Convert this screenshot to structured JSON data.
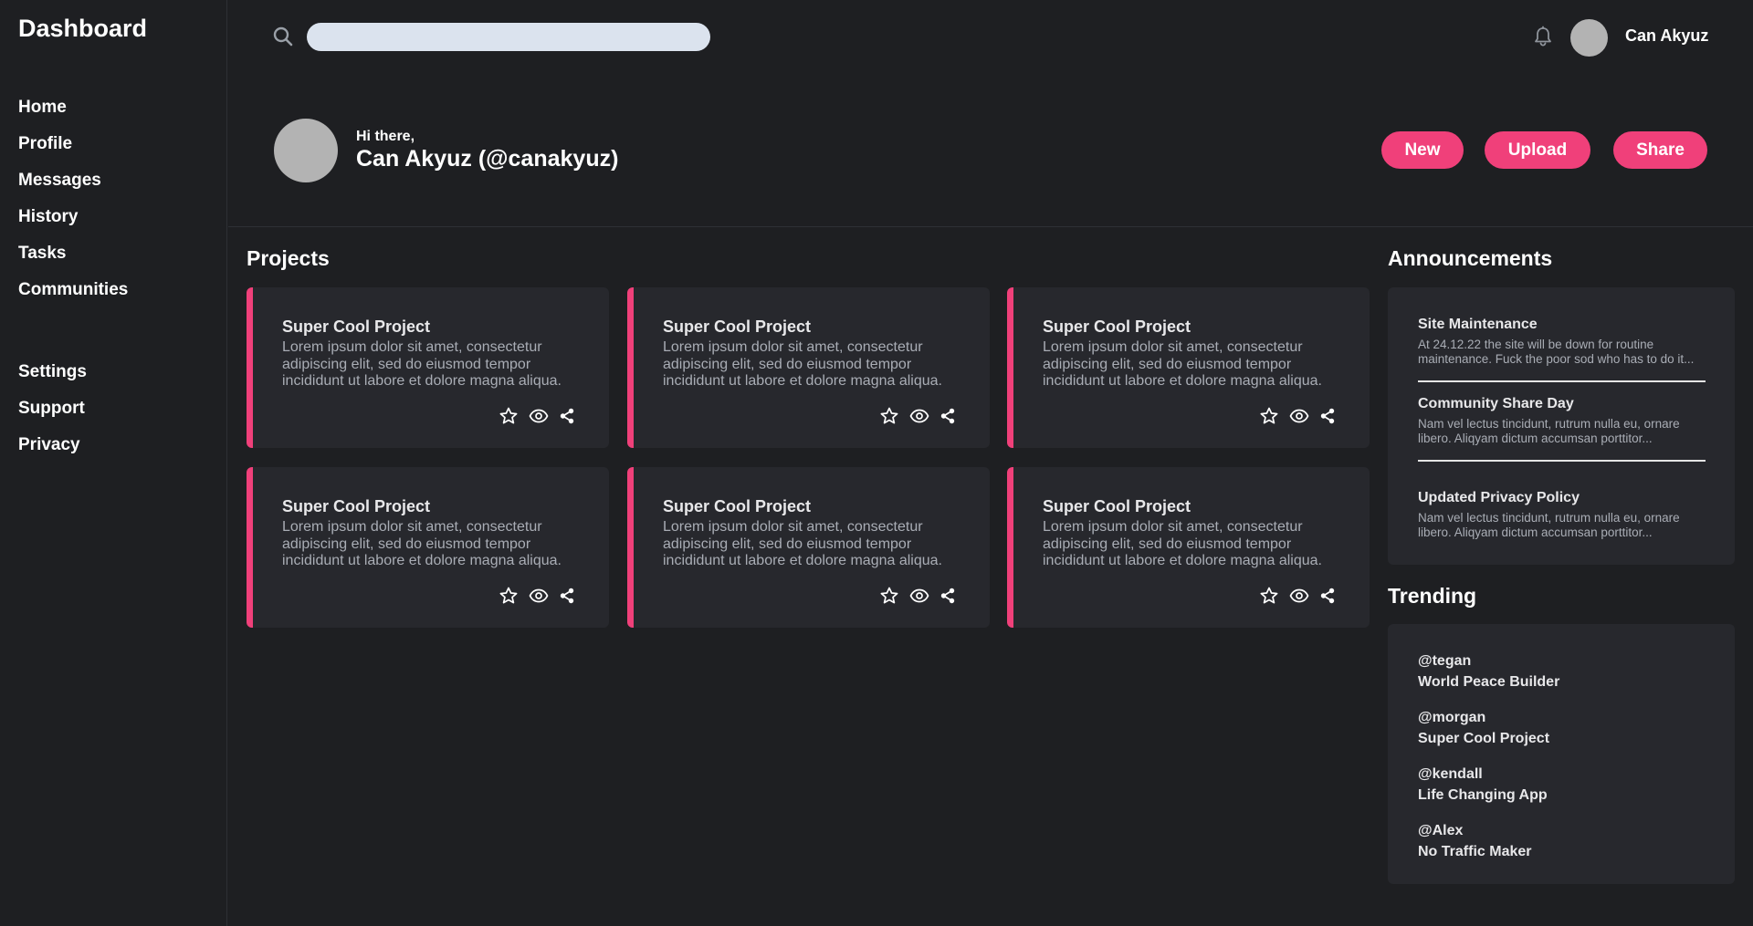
{
  "sidebar": {
    "brand": "Dashboard",
    "nav_primary": [
      "Home",
      "Profile",
      "Messages",
      "History",
      "Tasks",
      "Communities"
    ],
    "nav_secondary": [
      "Settings",
      "Support",
      "Privacy"
    ]
  },
  "topbar": {
    "search_placeholder": "",
    "username": "Can Akyuz"
  },
  "greeting": {
    "small": "Hi there,",
    "big": "Can Akyuz (@canakyuz)",
    "buttons": {
      "new": "New",
      "upload": "Upload",
      "share": "Share"
    }
  },
  "projects": {
    "title": "Projects",
    "cards": [
      {
        "title": "Super Cool Project",
        "desc": "Lorem ipsum dolor sit amet, consectetur adipiscing elit, sed do eiusmod tempor incididunt ut labore et dolore magna aliqua. Ut enim ad minim veniam"
      },
      {
        "title": "Super Cool Project",
        "desc": "Lorem ipsum dolor sit amet, consectetur adipiscing elit, sed do eiusmod tempor incididunt ut labore et dolore magna aliqua. Ut enim ad minim veniam"
      },
      {
        "title": "Super Cool Project",
        "desc": "Lorem ipsum dolor sit amet, consectetur adipiscing elit, sed do eiusmod tempor incididunt ut labore et dolore magna aliqua. Ut enim ad minim veniam"
      },
      {
        "title": "Super Cool Project",
        "desc": "Lorem ipsum dolor sit amet, consectetur adipiscing elit, sed do eiusmod tempor incididunt ut labore et dolore magna aliqua. Ut enim ad minim veniam"
      },
      {
        "title": "Super Cool Project",
        "desc": "Lorem ipsum dolor sit amet, consectetur adipiscing elit, sed do eiusmod tempor incididunt ut labore et dolore magna aliqua. Ut enim ad minim veniam"
      },
      {
        "title": "Super Cool Project",
        "desc": "Lorem ipsum dolor sit amet, consectetur adipiscing elit, sed do eiusmod tempor incididunt ut labore et dolore magna aliqua. Ut enim ad minim veniam"
      }
    ],
    "card_action_icons": [
      "star-icon",
      "eye-icon",
      "share-icon"
    ]
  },
  "announcements": {
    "title": "Announcements",
    "items": [
      {
        "title": "Site Maintenance",
        "text": "At 24.12.22 the site will be down for routine maintenance. Fuck the poor sod who has to do it..."
      },
      {
        "title": "Community Share Day",
        "text": "Nam vel lectus tincidunt, rutrum nulla eu, ornare libero. Aliqyam dictum accumsan porttitor..."
      },
      {
        "title": "Updated Privacy Policy",
        "text": "Nam vel lectus tincidunt, rutrum nulla eu, ornare libero. Aliqyam dictum accumsan porttitor..."
      }
    ]
  },
  "trending": {
    "title": "Trending",
    "items": [
      {
        "handle": "@tegan",
        "project": "World Peace Builder"
      },
      {
        "handle": "@morgan",
        "project": "Super Cool Project"
      },
      {
        "handle": "@kendall",
        "project": "Life Changing App"
      },
      {
        "handle": "@Alex",
        "project": "No Traffic Maker"
      }
    ]
  },
  "colors": {
    "background": "#1e1f22",
    "card": "#27282d",
    "accent": "#f0407a",
    "search_field": "#dbe3ee",
    "muted_text": "#a9adb5"
  }
}
